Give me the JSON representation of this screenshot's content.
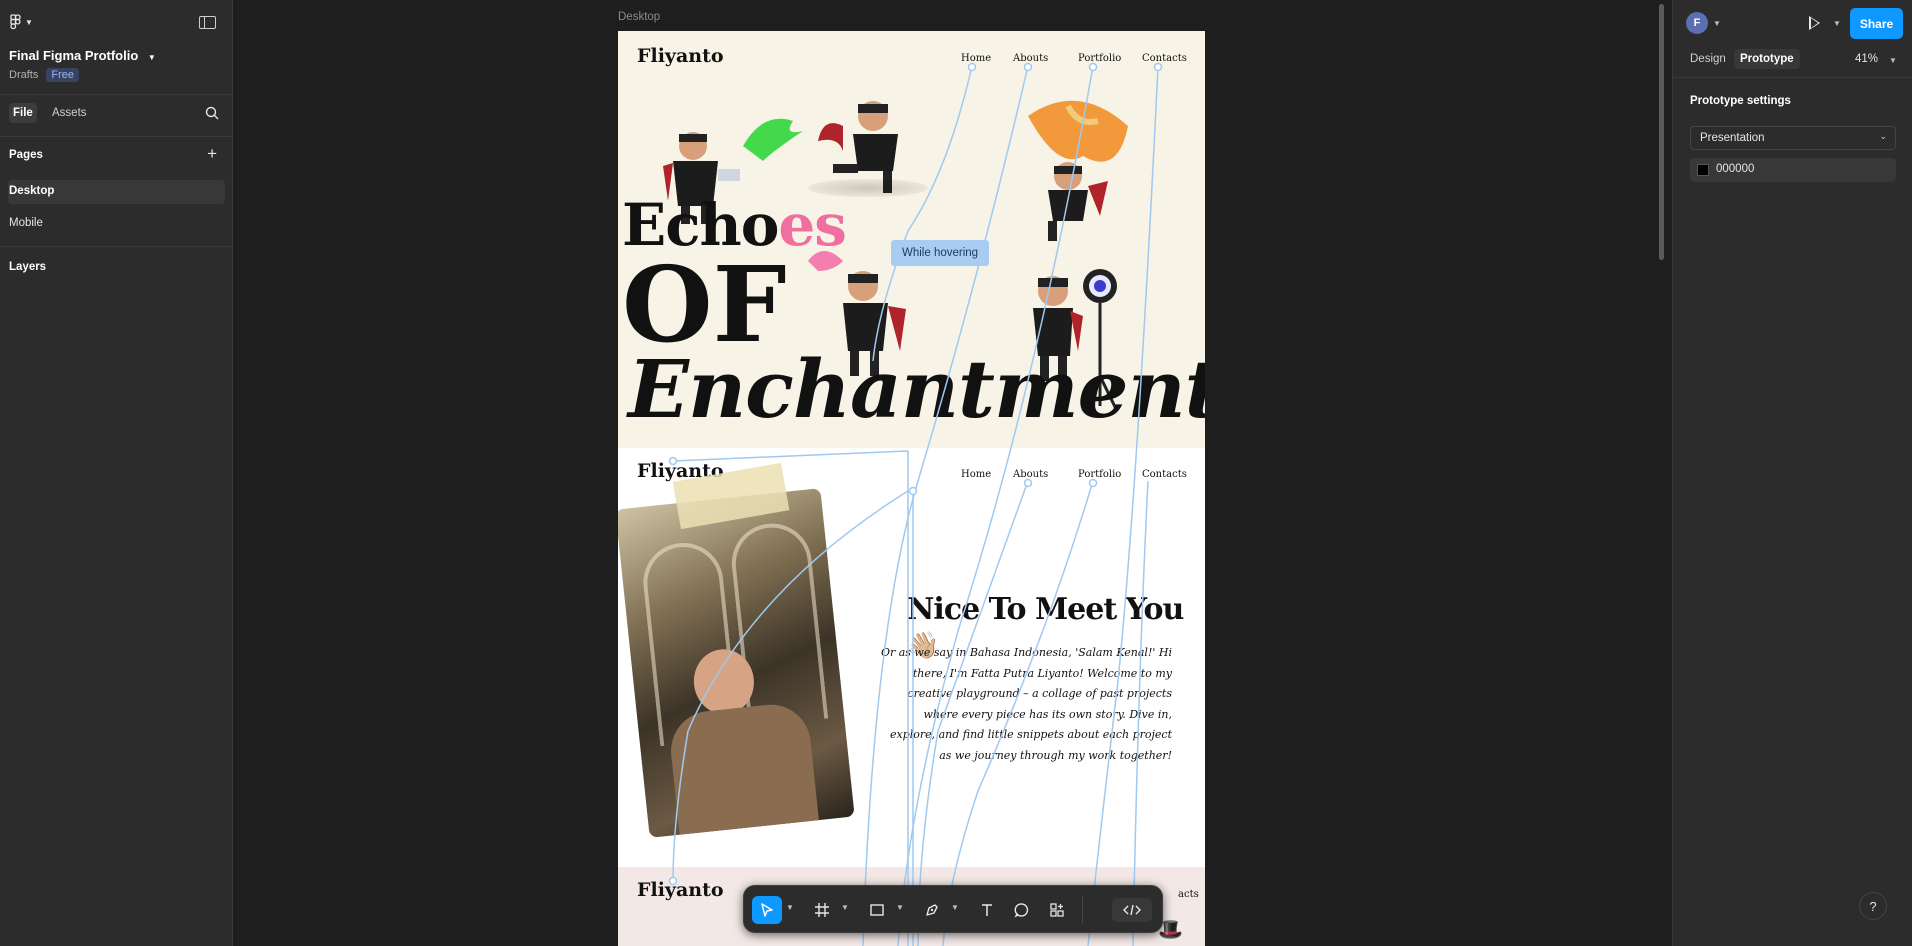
{
  "app": {
    "project_title": "Final Figma Protfolio",
    "project_location": "Drafts",
    "plan_badge": "Free"
  },
  "left_panel": {
    "tabs": [
      {
        "label": "File"
      },
      {
        "label": "Assets"
      }
    ],
    "pages_heading": "Pages",
    "pages": [
      {
        "label": "Desktop",
        "active": true
      },
      {
        "label": "Mobile",
        "active": false
      }
    ],
    "layers_heading": "Layers"
  },
  "canvas": {
    "frame_label": "Desktop",
    "hover_tooltip": "While hovering",
    "design": {
      "brand": "Fliyanto",
      "nav": [
        "Home",
        "Abouts",
        "Portfolio",
        "Contacts"
      ],
      "hero_title_part1": "Echo",
      "hero_title_part1_accent": "es",
      "hero_title_line2": "OF",
      "hero_title_line3": "Enchantment",
      "about_heading": "Nice To Meet You",
      "about_emoji": "👋🏼",
      "about_paragraph": "Or as we say in Bahasa Indonesia, 'Salam Kenal!' Hi there, I'm Fatta Putra Liyanto! Welcome to my creative playground – a collage of past projects where every piece has its own story. Dive in, explore, and find little snippets about each project as we journey through my work together!",
      "section3_brand": "Fliyanto",
      "section3_nav_partial": "acts"
    }
  },
  "toolbar": {
    "tools": [
      "move-tool",
      "frame-tool",
      "shape-tool",
      "pen-tool",
      "text-tool",
      "comment-tool",
      "actions-tool",
      "dev-mode-toggle"
    ]
  },
  "right_panel": {
    "user_initial": "F",
    "share_label": "Share",
    "tabs": [
      {
        "label": "Design"
      },
      {
        "label": "Prototype",
        "active": true
      }
    ],
    "zoom": "41%",
    "settings_heading": "Prototype settings",
    "device": "Presentation",
    "background_color": "000000"
  },
  "help_label": "?",
  "colors": {
    "accent": "#0d99ff",
    "canvas_bg": "#1e1e1e",
    "panel_bg": "#2c2c2c",
    "hero_bg": "#f7f3e6",
    "hero_accent_pink": "#f06fa0",
    "prototype_link": "#a9cdf2"
  }
}
